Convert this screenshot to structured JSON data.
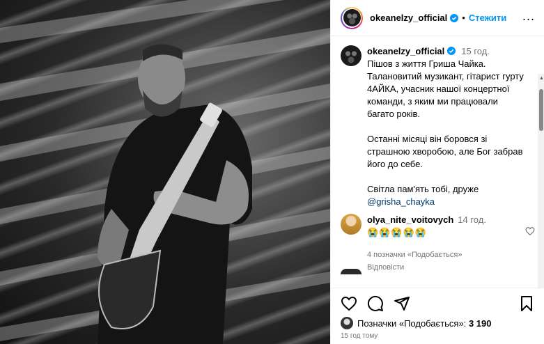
{
  "header": {
    "username": "okeanelzy_official",
    "separator": "•",
    "follow_label": "Стежити",
    "more_label": "..."
  },
  "caption": {
    "username": "okeanelzy_official",
    "time": "15 год.",
    "paragraphs": [
      "Пішов з життя Гриша Чайка. Талановитий музикант, гітарист гурту 4АЙКА, учасник нашої концертної команди, з яким ми працювали багато років.",
      "Останні місяці він боровся зі страшною хворобою, але Бог забрав його до себе.",
      "Світла пам'ять тобі, друже"
    ],
    "mention": "@grisha_chayka"
  },
  "comment": {
    "username": "olya_nite_voitovych",
    "time": "14 год.",
    "emojis": "😭😭😭😭😭",
    "likes_label": "4 позначки «Подобається»",
    "reply_label": "Відповісти"
  },
  "actions": {
    "likes_prefix": "Позначки «Подобається»:",
    "likes_count": "3 190",
    "post_time": "15 год тому"
  },
  "colors": {
    "accent": "#0095f6",
    "secondary_text": "#737373",
    "mention": "#00376b"
  }
}
